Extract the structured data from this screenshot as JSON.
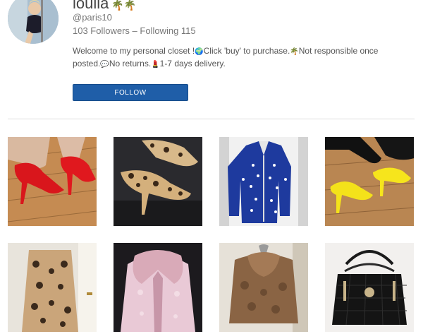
{
  "profile": {
    "name": "loulia",
    "name_icon": "palm-trees",
    "handle": "@paris10",
    "stats": "103 Followers – Following 115",
    "bio": {
      "part1": "Welcome to my personal closet !",
      "part2": "Click 'buy' to purchase.",
      "part3": "Not responsible once posted.",
      "part4": "No returns.",
      "part5": "1-7 days delivery."
    },
    "follow_label": "FOLLOW"
  },
  "colors": {
    "follow_button": "#1f5ea8",
    "divider": "#dddddd"
  },
  "listings": [
    {
      "icon": "red-heels-photo"
    },
    {
      "icon": "leopard-heels-photo"
    },
    {
      "icon": "star-jacket-photo"
    },
    {
      "icon": "yellow-heels-photo"
    },
    {
      "icon": "leopard-coat-photo"
    },
    {
      "icon": "pink-fur-jacket-photo"
    },
    {
      "icon": "brown-fur-jacket-photo"
    },
    {
      "icon": "black-handbag-photo"
    }
  ]
}
